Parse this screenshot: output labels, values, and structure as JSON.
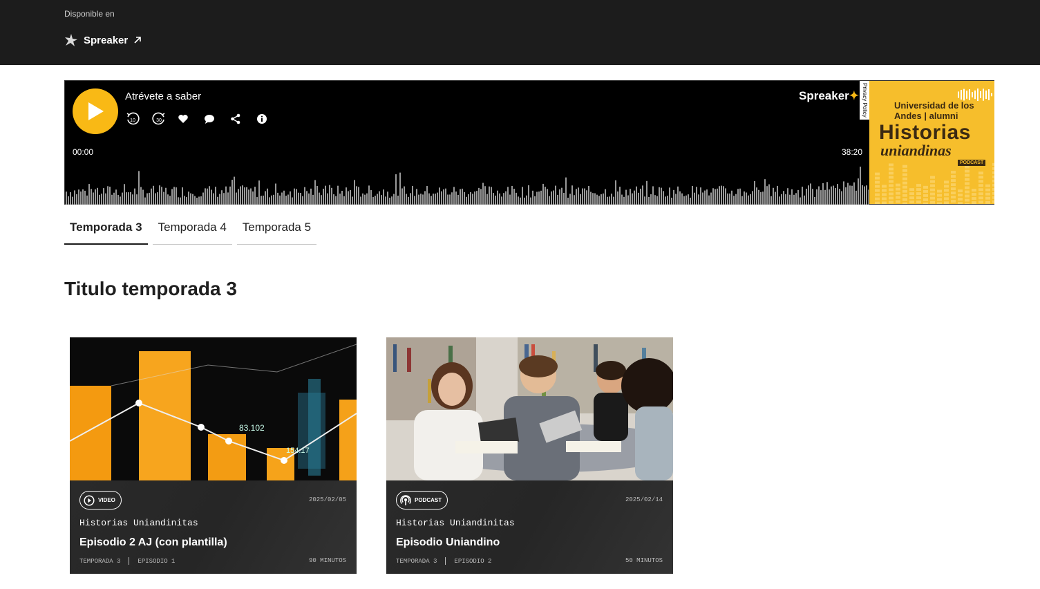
{
  "header": {
    "available_label": "Disponible en",
    "spreaker_link": "Spreaker"
  },
  "player": {
    "title": "Atrévete a saber",
    "time_start": "00:00",
    "time_end": "38:20",
    "brand": "Spreaker",
    "privacy": "Privacy Policy",
    "cover": {
      "university": "Universidad de los Andes | alumni",
      "title_line1": "Historias",
      "title_line2": "uniandinas",
      "podcast_tag": "PODCAST"
    },
    "controls": [
      "rewind-10-icon",
      "forward-30-icon",
      "heart-icon",
      "comment-icon",
      "share-icon",
      "info-icon"
    ],
    "accent": "#f9b915"
  },
  "tabs": [
    {
      "label": "Temporada 3",
      "active": true
    },
    {
      "label": "Temporada 4",
      "active": false
    },
    {
      "label": "Temporada 5",
      "active": false
    }
  ],
  "season_title": "Titulo temporada 3",
  "episodes": [
    {
      "badge": "VIDEO",
      "date": "2025/02/05",
      "series": "Historias Uniandinitas",
      "title": "Episodio 2 AJ (con plantilla)",
      "season": "TEMPORADA 3",
      "episode": "EPISODIO 1",
      "duration": "90 MINUTOS",
      "image_text_1": "83.102",
      "image_text_2": "154.17"
    },
    {
      "badge": "PODCAST",
      "date": "2025/02/14",
      "series": "Historias Uniandinitas",
      "title": "Episodio Uniandino",
      "season": "TEMPORADA 3",
      "episode": "EPISODIO 2",
      "duration": "50 MINUTOS"
    }
  ]
}
